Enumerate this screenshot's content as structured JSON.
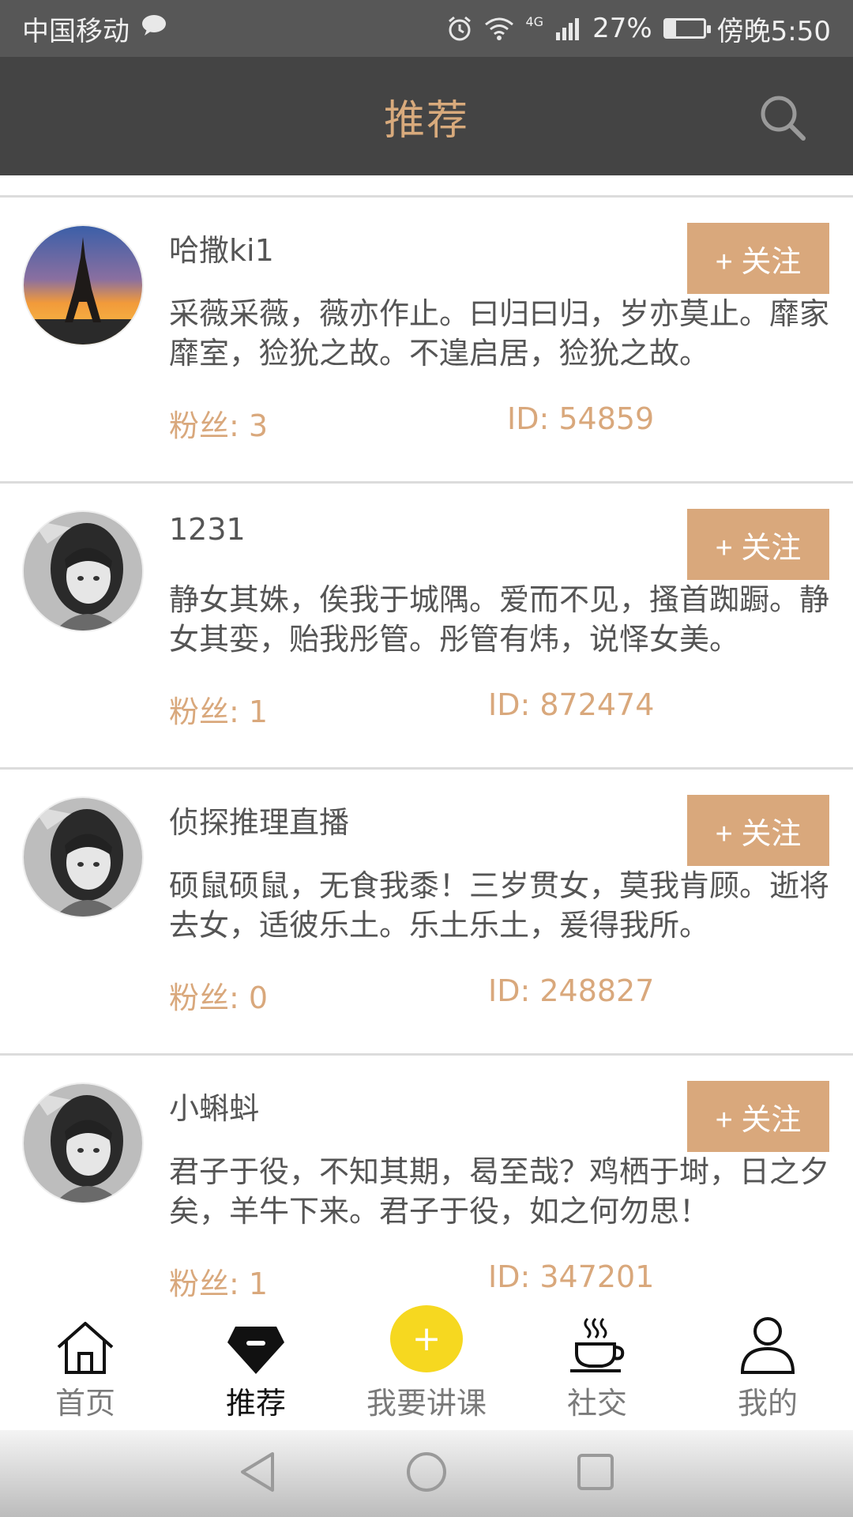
{
  "status_bar": {
    "carrier": "中国移动",
    "network": "4G",
    "battery": "27%",
    "battery_level": 0.27,
    "time": "傍晚5:50"
  },
  "header": {
    "title": "推荐",
    "search_icon": "search-icon"
  },
  "users": [
    {
      "name": "哈撒ki1",
      "follow_label": "+ 关注",
      "bio": "采薇采薇，薇亦作止。曰归曰归，岁亦莫止。靡家靡室，猃狁之故。不遑启居，猃狁之故。",
      "fans": "粉丝: 3",
      "id": "ID: 54859",
      "avatar": "eiffel-tower-sunset"
    },
    {
      "name": "1231",
      "follow_label": "+ 关注",
      "bio": "静女其姝，俟我于城隅。爱而不见，搔首踟蹰。静女其娈，贻我彤管。彤管有炜，说怿女美。",
      "fans": "粉丝: 1",
      "id": "ID: 872474",
      "avatar": "girl-portrait-bw"
    },
    {
      "name": "侦探推理直播",
      "follow_label": "+ 关注",
      "bio": "硕鼠硕鼠，无食我黍！三岁贯女，莫我肯顾。逝将去女，适彼乐土。乐土乐土，爰得我所。",
      "fans": "粉丝: 0",
      "id": "ID: 248827",
      "avatar": "girl-portrait-bw"
    },
    {
      "name": "小蝌蚪",
      "follow_label": "+ 关注",
      "bio": "君子于役，不知其期，曷至哉？鸡栖于埘，日之夕矣，羊牛下来。君子于役，如之何勿思！",
      "fans": "粉丝: 1",
      "id": "ID: 347201",
      "avatar": "girl-portrait-bw"
    }
  ],
  "bottom_nav": {
    "items": [
      {
        "label": "首页",
        "icon": "home-icon"
      },
      {
        "label": "推荐",
        "icon": "diamond-icon"
      },
      {
        "label": "我要讲课",
        "icon": "plus-icon"
      },
      {
        "label": "社交",
        "icon": "coffee-icon"
      },
      {
        "label": "我的",
        "icon": "user-icon"
      }
    ],
    "active_index": 1,
    "center_button": "+"
  },
  "colors": {
    "accent": "#d9a87c",
    "header_bg": "#444444",
    "status_bg": "#575757",
    "center_button": "#f6d820"
  }
}
